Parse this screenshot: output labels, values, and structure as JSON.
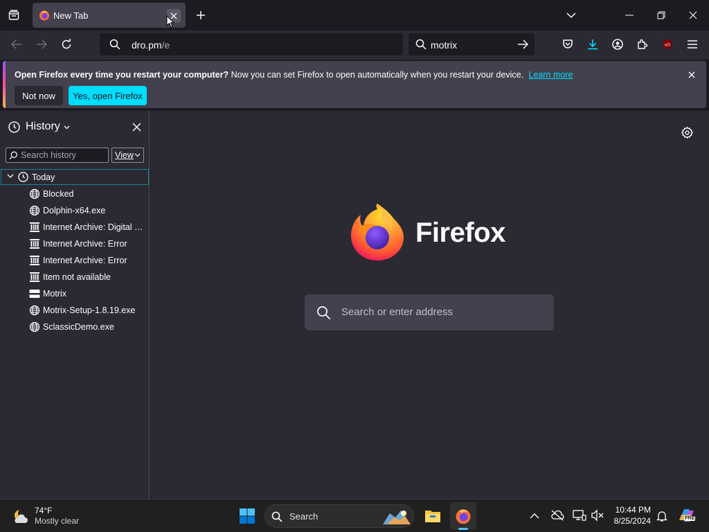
{
  "browser": {
    "tab": {
      "title": "New Tab"
    },
    "address_bar": {
      "value_main": "dro.pm",
      "value_path": "/e"
    },
    "search_bar": {
      "value": "motrix"
    }
  },
  "notification": {
    "bold_text": "Open Firefox every time you restart your computer?",
    "text": "Now you can set Firefox to open automatically when you restart your device.",
    "link": "Learn more",
    "secondary_button": "Not now",
    "primary_button": "Yes, open Firefox"
  },
  "sidebar": {
    "title": "History",
    "search_placeholder": "Search history",
    "view_button": "View",
    "group": "Today",
    "items": [
      {
        "label": "Blocked",
        "icon": "globe-icon"
      },
      {
        "label": "Dolphin-x64.exe",
        "icon": "globe-icon"
      },
      {
        "label": "Internet Archive: Digital Li...",
        "icon": "archive-icon"
      },
      {
        "label": "Internet Archive: Error",
        "icon": "archive-icon"
      },
      {
        "label": "Internet Archive: Error",
        "icon": "archive-icon"
      },
      {
        "label": "Item not available",
        "icon": "archive-icon"
      },
      {
        "label": "Motrix",
        "icon": "motrix-icon"
      },
      {
        "label": "Motrix-Setup-1.8.19.exe",
        "icon": "globe-icon"
      },
      {
        "label": "SclassicDemo.exe",
        "icon": "globe-icon"
      }
    ]
  },
  "newtab": {
    "brand": "Firefox",
    "search_placeholder": "Search or enter address"
  },
  "taskbar": {
    "weather_temp": "74°F",
    "weather_desc": "Mostly clear",
    "search_label": "Search",
    "time": "10:44 PM",
    "date": "8/25/2024",
    "copilot_badge": "PRE"
  },
  "colors": {
    "accent": "#00ddff",
    "panel": "#42414d",
    "bg": "#2b2a33"
  }
}
